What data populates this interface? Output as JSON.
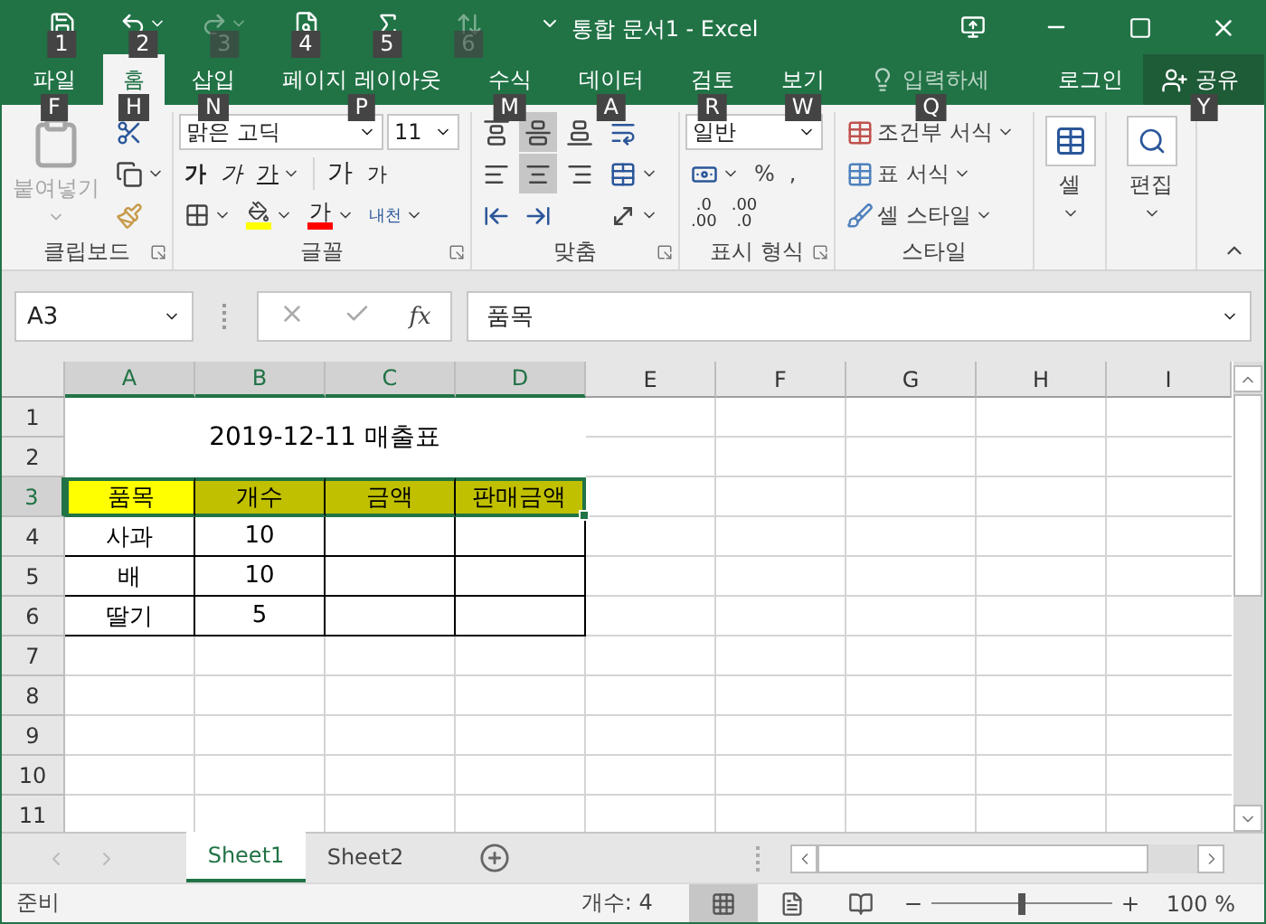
{
  "quick_access": [
    {
      "kind": "save",
      "keytip": "1",
      "disabled": false
    },
    {
      "kind": "undo",
      "keytip": "2",
      "disabled": false
    },
    {
      "kind": "redo",
      "keytip": "3",
      "disabled": true
    },
    {
      "kind": "print_preview",
      "keytip": "4",
      "disabled": false
    },
    {
      "kind": "sum",
      "keytip": "5",
      "disabled": false
    },
    {
      "kind": "sort",
      "keytip": "6",
      "disabled": true
    }
  ],
  "window": {
    "title": "통합 문서1 - Excel"
  },
  "tabs": [
    {
      "label": "파일",
      "keytip": "F",
      "selected": false
    },
    {
      "label": "홈",
      "keytip": "H",
      "selected": true
    },
    {
      "label": "삽입",
      "keytip": "N",
      "selected": false
    },
    {
      "label": "페이지 레이아웃",
      "keytip": "P",
      "selected": false
    },
    {
      "label": "수식",
      "keytip": "M",
      "selected": false
    },
    {
      "label": "데이터",
      "keytip": "A",
      "selected": false
    },
    {
      "label": "검토",
      "keytip": "R",
      "selected": false
    },
    {
      "label": "보기",
      "keytip": "W",
      "selected": false
    }
  ],
  "tell_me": {
    "placeholder": "입력하세",
    "keytip": "Q"
  },
  "sign_in": "로그인",
  "share": {
    "label": "공유",
    "keytip": "Y"
  },
  "ribbon": {
    "clipboard": {
      "label": "클립보드",
      "paste": {
        "label": "붙여넣기",
        "disabled": true
      }
    },
    "font": {
      "label": "글꼴",
      "name": "맑은 고딕",
      "size": "11",
      "bold": "가",
      "italic": "가",
      "underline": "가",
      "grow": "가",
      "shrink": "가",
      "font_color": "가",
      "phonetic": "내천"
    },
    "alignment": {
      "label": "맞춤",
      "vertical": [
        {
          "kind": "top",
          "selected": false
        },
        {
          "kind": "middle",
          "selected": true
        },
        {
          "kind": "bottom",
          "selected": false
        }
      ],
      "horizontal": [
        {
          "kind": "left",
          "selected": false
        },
        {
          "kind": "center",
          "selected": true
        },
        {
          "kind": "right",
          "selected": false
        }
      ]
    },
    "number": {
      "label": "표시 형식",
      "format": "일반",
      "percent": "%",
      "comma": ",",
      "increase_decimal": [
        ".0",
        ".00"
      ],
      "decrease_decimal": [
        ".00",
        ".0"
      ]
    },
    "styles": {
      "label": "스타일",
      "items": [
        "조건부 서식",
        "표 서식",
        "셀 스타일"
      ]
    },
    "cells": {
      "label": "셀"
    },
    "editing": {
      "label": "편집"
    }
  },
  "formula_bar": {
    "name_box": "A3",
    "function_label": "fx",
    "formula": "품목"
  },
  "sheet": {
    "columns": [
      {
        "label": "A",
        "selected": true
      },
      {
        "label": "B",
        "selected": true
      },
      {
        "label": "C",
        "selected": true
      },
      {
        "label": "D",
        "selected": true
      },
      {
        "label": "E",
        "selected": false
      },
      {
        "label": "F",
        "selected": false
      },
      {
        "label": "G",
        "selected": false
      },
      {
        "label": "H",
        "selected": false
      },
      {
        "label": "I",
        "selected": false
      }
    ],
    "rows": [
      {
        "label": "1",
        "selected": false
      },
      {
        "label": "2",
        "selected": false
      },
      {
        "label": "3",
        "selected": true
      },
      {
        "label": "4",
        "selected": false
      },
      {
        "label": "5",
        "selected": false
      },
      {
        "label": "6",
        "selected": false
      },
      {
        "label": "7",
        "selected": false
      },
      {
        "label": "8",
        "selected": false
      },
      {
        "label": "9",
        "selected": false
      },
      {
        "label": "10",
        "selected": false
      },
      {
        "label": "11",
        "selected": false
      }
    ],
    "title": "2019-12-11 매출표",
    "table": [
      [
        {
          "text": "품목",
          "color": "#ffff00"
        },
        {
          "text": "개수",
          "color": "#c0c000"
        },
        {
          "text": "금액",
          "color": "#c0c000"
        },
        {
          "text": "판매금액",
          "color": "#c0c000"
        }
      ],
      [
        {
          "text": "사과"
        },
        {
          "text": "10"
        }
      ],
      [
        {
          "text": "배"
        },
        {
          "text": "10"
        }
      ],
      [
        {
          "text": "딸기"
        },
        {
          "text": "5"
        }
      ]
    ]
  },
  "sheet_tabs": [
    {
      "label": "Sheet1",
      "selected": true
    },
    {
      "label": "Sheet2",
      "selected": false
    }
  ],
  "status_bar": {
    "mode": "준비",
    "count": "개수: 4",
    "views": [
      {
        "kind": "normal",
        "selected": true
      },
      {
        "kind": "page_layout",
        "selected": false
      },
      {
        "kind": "page_break",
        "selected": false
      }
    ],
    "zoom": {
      "level": 0.5,
      "reading": "100 %"
    }
  }
}
